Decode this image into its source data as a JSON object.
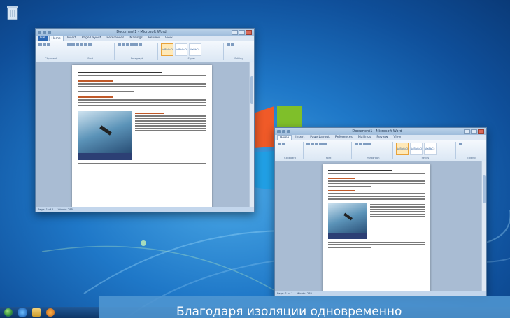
{
  "desktop": {
    "icons": [
      {
        "name": "recycle-bin-icon"
      }
    ],
    "caption": "Благодаря изоляции одновременно"
  },
  "window_front": {
    "title": "Document1 - Microsoft Word",
    "tabs": [
      {
        "label": "File",
        "active": false,
        "file": true
      },
      {
        "label": "Home",
        "active": true
      },
      {
        "label": "Insert",
        "active": false
      },
      {
        "label": "Page Layout",
        "active": false
      },
      {
        "label": "References",
        "active": false
      },
      {
        "label": "Mailings",
        "active": false
      },
      {
        "label": "Review",
        "active": false
      },
      {
        "label": "View",
        "active": false
      }
    ],
    "ribbon": {
      "groups": [
        "Clipboard",
        "Font",
        "Paragraph",
        "Styles",
        "Editing"
      ],
      "styles": [
        {
          "label": "AaBbCcDc",
          "sub": "Normal",
          "selected": true
        },
        {
          "label": "AaBbCcDc",
          "sub": "No Spaci...",
          "selected": false
        },
        {
          "label": "AaBbCc",
          "sub": "Heading 1",
          "selected": false
        }
      ]
    },
    "status": {
      "page": "Page: 1 of 1",
      "words": "Words: 285"
    }
  },
  "window_back": {
    "title": "Document1 - Microsoft Word",
    "tabs": [
      {
        "label": "Home",
        "active": true
      },
      {
        "label": "Insert",
        "active": false
      },
      {
        "label": "Page Layout",
        "active": false
      },
      {
        "label": "References",
        "active": false
      },
      {
        "label": "Mailings",
        "active": false
      },
      {
        "label": "Review",
        "active": false
      },
      {
        "label": "View",
        "active": false
      }
    ],
    "ribbon": {
      "groups": [
        "Clipboard",
        "Font",
        "Paragraph",
        "Styles",
        "Editing"
      ],
      "styles": [
        {
          "label": "AaBbCcDc",
          "sub": "Normal",
          "selected": true
        },
        {
          "label": "AaBbCcDc",
          "sub": "No Spaci...",
          "selected": false
        },
        {
          "label": "AaBbCc",
          "sub": "Heading 1",
          "selected": false
        }
      ]
    },
    "status": {
      "page": "Page: 1 of 1",
      "words": "Words: 285"
    }
  },
  "taskbar": {
    "items": [
      "start-orb",
      "internet-explorer-icon",
      "folder-icon",
      "media-player-icon"
    ]
  },
  "colors": {
    "desktop": "#1f78c8",
    "caption_bg": "#5096d2",
    "heading": "#c05a2a"
  }
}
